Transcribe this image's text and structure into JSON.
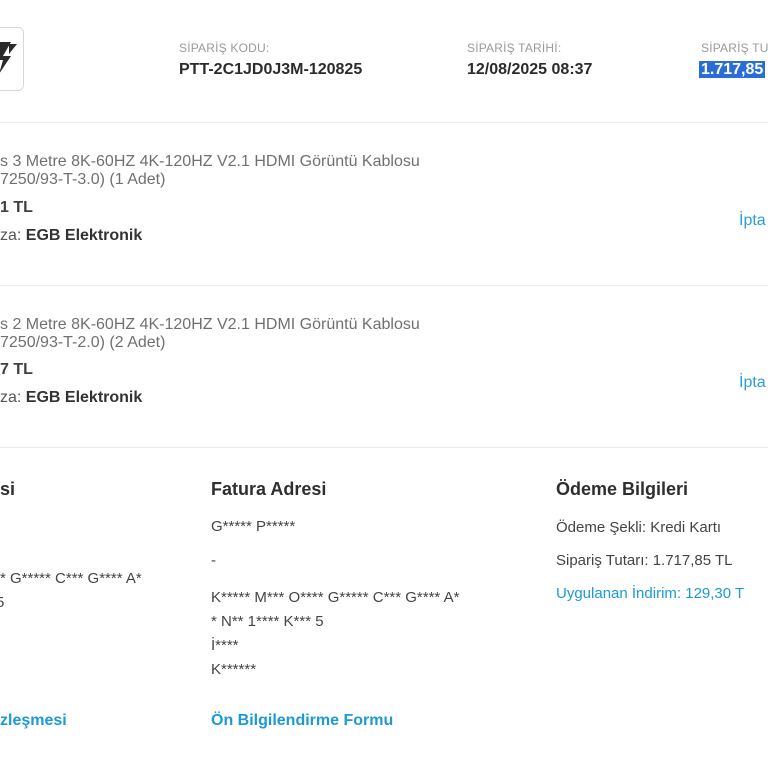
{
  "header": {
    "order_code_label": "SİPARİŞ KODU:",
    "order_code": "PTT-2C1JD0J3M-120825",
    "order_date_label": "SİPARİŞ TARİHİ:",
    "order_date": "12/08/2025 08:37",
    "order_total_label": "SİPARİŞ TU",
    "order_total": "1.717,85 "
  },
  "items": [
    {
      "name_line1": "s 3 Metre 8K-60HZ 4K-120HZ V2.1 HDMI Görüntü Kablosu",
      "name_line2": "7250/93-T-3.0) (1 Adet)",
      "price": "1 TL",
      "store_label": "za: ",
      "store_name": "EGB Elektronik",
      "cancel_label": "İpta"
    },
    {
      "name_line1": "s 2 Metre 8K-60HZ 4K-120HZ V2.1 HDMI Görüntü Kablosu",
      "name_line2": "7250/93-T-2.0) (2 Adet)",
      "price": "7 TL",
      "store_label": "za: ",
      "store_name": "EGB Elektronik",
      "cancel_label": "İpta"
    }
  ],
  "delivery": {
    "title": "si",
    "line1": "* G***** C*** G**** A*",
    "line2": "5",
    "contract_link": "zleşmesi"
  },
  "billing": {
    "title": "Fatura Adresi",
    "name": "G***** P*****",
    "dash": "-",
    "addr1": "K***** M*** O**** G***** C*** G**** A*",
    "addr2": "* N** 1**** K*** 5",
    "addr3": "İ****",
    "addr4": "K******",
    "info_form_link": "Ön Bilgilendirme Formu"
  },
  "payment": {
    "title": "Ödeme Bilgileri",
    "method": "Ödeme Şekli: Kredi Kartı",
    "total": "Sipariş Tutarı: 1.717,85 TL",
    "discount": "Uygulanan İndirim: 129,30 T"
  },
  "colors": {
    "accent": "#1b9ad6",
    "highlight": "#2a6dd6",
    "divider": "#ececec"
  }
}
